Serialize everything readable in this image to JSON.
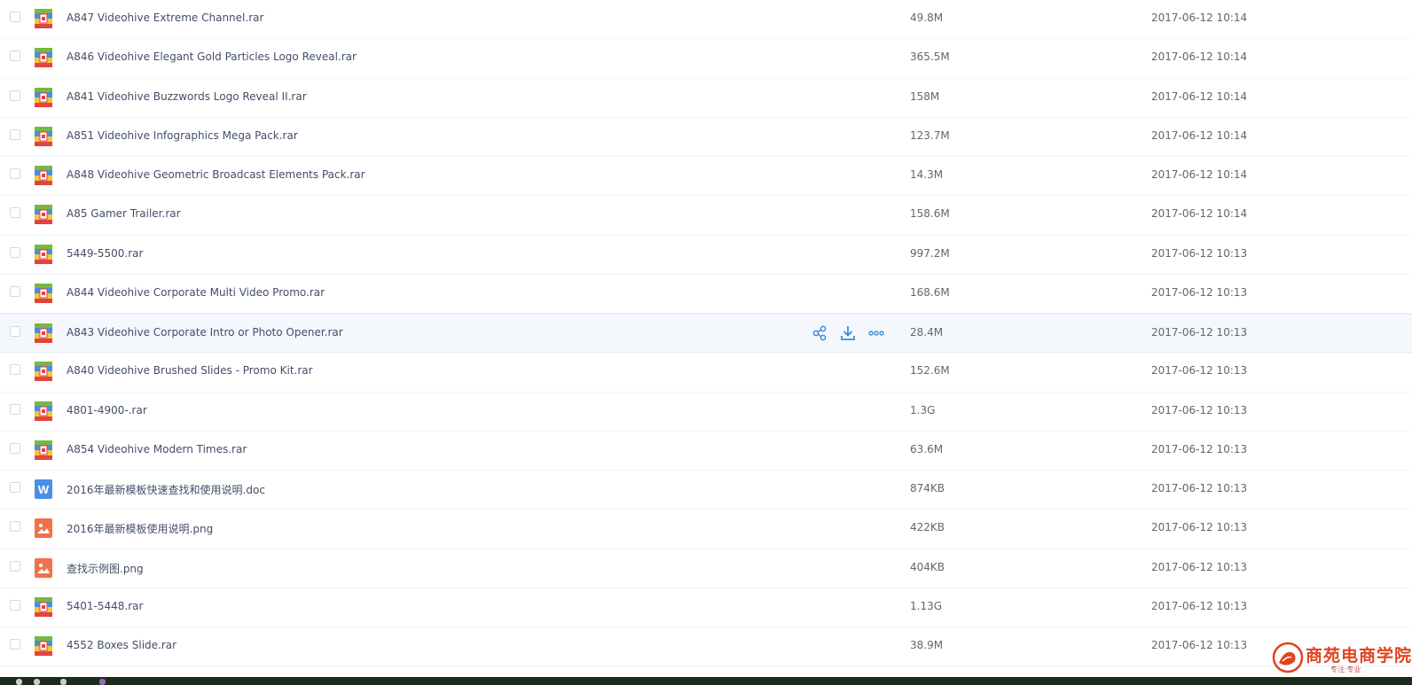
{
  "files": [
    {
      "name": "A847 Videohive Extreme Channel.rar",
      "size": "49.8M",
      "date": "2017-06-12 10:14",
      "type": "rar-icon"
    },
    {
      "name": "A846 Videohive Elegant Gold Particles Logo Reveal.rar",
      "size": "365.5M",
      "date": "2017-06-12 10:14",
      "type": "rar-icon"
    },
    {
      "name": "A841 Videohive Buzzwords Logo Reveal II.rar",
      "size": "158M",
      "date": "2017-06-12 10:14",
      "type": "rar-icon"
    },
    {
      "name": "A851 Videohive Infographics Mega Pack.rar",
      "size": "123.7M",
      "date": "2017-06-12 10:14",
      "type": "rar-icon"
    },
    {
      "name": "A848 Videohive Geometric Broadcast Elements Pack.rar",
      "size": "14.3M",
      "date": "2017-06-12 10:14",
      "type": "rar-icon"
    },
    {
      "name": "A85 Gamer Trailer.rar",
      "size": "158.6M",
      "date": "2017-06-12 10:14",
      "type": "rar-icon"
    },
    {
      "name": "5449-5500.rar",
      "size": "997.2M",
      "date": "2017-06-12 10:13",
      "type": "rar-icon"
    },
    {
      "name": "A844 Videohive Corporate Multi Video Promo.rar",
      "size": "168.6M",
      "date": "2017-06-12 10:13",
      "type": "rar-icon"
    },
    {
      "name": "A843 Videohive Corporate Intro or Photo Opener.rar",
      "size": "28.4M",
      "date": "2017-06-12 10:13",
      "type": "rar-icon"
    },
    {
      "name": "A840 Videohive Brushed Slides - Promo Kit.rar",
      "size": "152.6M",
      "date": "2017-06-12 10:13",
      "type": "rar-icon"
    },
    {
      "name": "4801-4900-.rar",
      "size": "1.3G",
      "date": "2017-06-12 10:13",
      "type": "rar-icon"
    },
    {
      "name": "A854 Videohive Modern Times.rar",
      "size": "63.6M",
      "date": "2017-06-12 10:13",
      "type": "rar-icon"
    },
    {
      "name": "2016年最新模板快速查找和使用说明.doc",
      "size": "874KB",
      "date": "2017-06-12 10:13",
      "type": "word-doc-icon"
    },
    {
      "name": "2016年最新模板使用说明.png",
      "size": "422KB",
      "date": "2017-06-12 10:13",
      "type": "image-file-icon"
    },
    {
      "name": "查找示例图.png",
      "size": "404KB",
      "date": "2017-06-12 10:13",
      "type": "image-file-icon"
    },
    {
      "name": "5401-5448.rar",
      "size": "1.13G",
      "date": "2017-06-12 10:13",
      "type": "rar-icon"
    },
    {
      "name": "4552 Boxes Slide.rar",
      "size": "38.9M",
      "date": "2017-06-12 10:13",
      "type": "rar-icon"
    }
  ],
  "hovered_row_index": 8,
  "row_actions": [
    "share-icon",
    "download-icon",
    "more-icon"
  ],
  "watermark": {
    "title": "商苑电商学院",
    "subtitle": "专注·专业"
  },
  "colors": {
    "accent": "#3b8cd4",
    "hover_row": "#f4f8fd",
    "rar_red": "#e0463f",
    "rar_green": "#78b743",
    "rar_blue": "#4b8fd9",
    "rar_yellow": "#f5c53c",
    "word_blue": "#4a90e2",
    "image_orange": "#f0714a"
  }
}
